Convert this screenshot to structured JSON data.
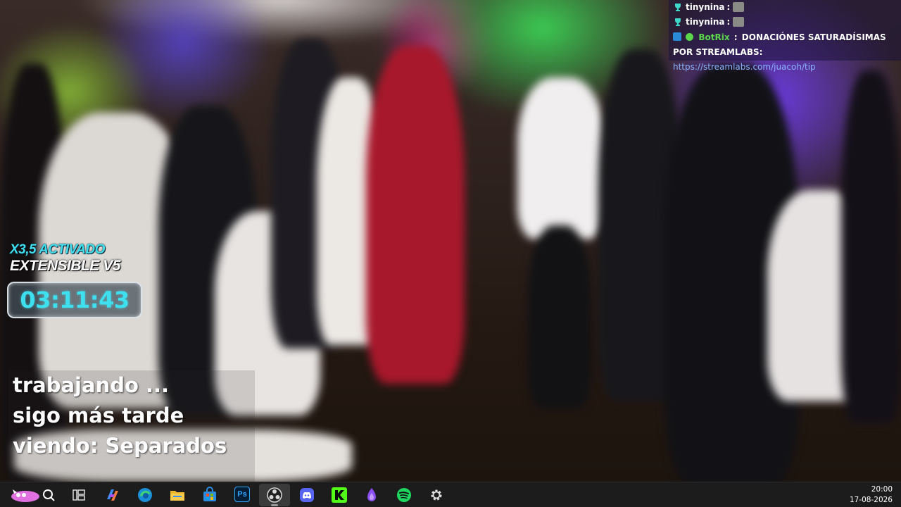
{
  "chat": {
    "messages": [
      {
        "user": "tinynina",
        "separator": ":",
        "text": ""
      },
      {
        "user": "tinynina",
        "separator": ":",
        "text": ""
      },
      {
        "user": "BotRix",
        "separator": ":",
        "text": "DONACIÓNES SATURADÍSIMAS POR STREAMLABS:",
        "link": "https://streamlabs.com/juacoh/tip"
      }
    ]
  },
  "multiplier": {
    "line1": "X3,5 ACTIVADO",
    "line2": "EXTENSIBLE V5",
    "timer": "03:11:43"
  },
  "status": {
    "line1": "trabajando ...",
    "line2": "sigo más tarde",
    "line3": "viendo: Separados"
  },
  "taskbar": {
    "time": "20:00",
    "date": "17-08-2026",
    "icons": [
      "start-icon",
      "search-icon",
      "task-view-icon",
      "copilot-icon",
      "edge-icon",
      "file-explorer-icon",
      "store-icon",
      "photoshop-icon",
      "obs-icon",
      "discord-icon",
      "kick-icon",
      "streamer-app-icon",
      "spotify-icon",
      "settings-icon"
    ],
    "photoshop_label": "Ps"
  },
  "colors": {
    "accent_cyan": "#3ee0f0",
    "bot_green": "#5bd64a",
    "link_blue": "#8ab4ff",
    "taskbar_bg": "#1c1c1c"
  }
}
